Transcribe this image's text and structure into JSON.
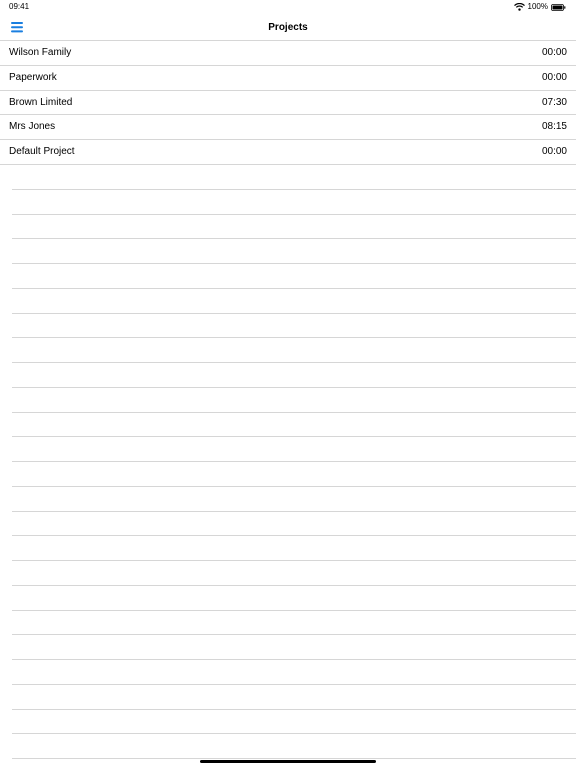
{
  "status_bar": {
    "time": "09:41",
    "battery_percent": "100%",
    "wifi_icon": "wifi-icon",
    "battery_icon": "battery-icon"
  },
  "nav": {
    "title": "Projects",
    "menu_icon": "hamburger-menu-icon",
    "accent_color": "#1a7fe0"
  },
  "projects": [
    {
      "name": "Wilson Family",
      "time": "00:00"
    },
    {
      "name": "Paperwork",
      "time": "00:00"
    },
    {
      "name": "Brown Limited",
      "time": "07:30"
    },
    {
      "name": "Mrs Jones",
      "time": "08:15"
    },
    {
      "name": "Default Project",
      "time": "00:00"
    }
  ]
}
